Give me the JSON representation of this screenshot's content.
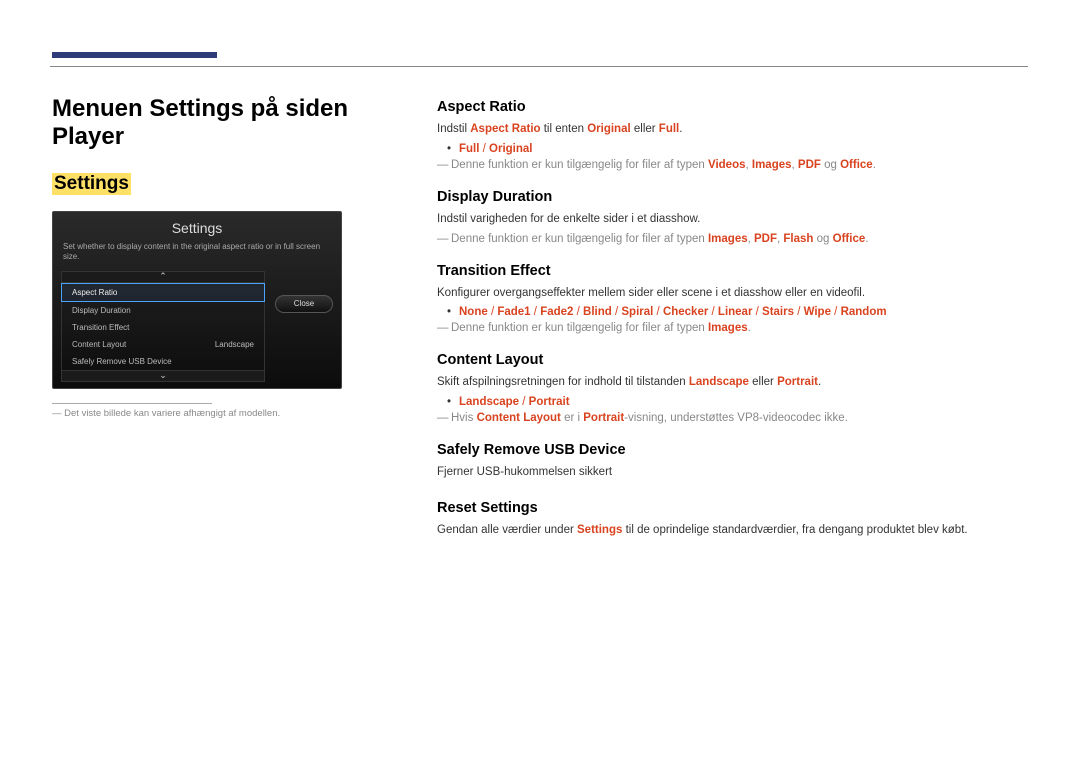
{
  "page_title": "Menuen Settings på siden Player",
  "settings_label": "Settings",
  "panel": {
    "title": "Settings",
    "subtitle": "Set whether to display content in the original aspect ratio or in full screen size.",
    "scroll_up": "⌃",
    "scroll_down": "⌄",
    "close": "Close",
    "items": [
      {
        "label": "Aspect Ratio",
        "value": "",
        "selected": true
      },
      {
        "label": "Display Duration",
        "value": ""
      },
      {
        "label": "Transition Effect",
        "value": ""
      },
      {
        "label": "Content Layout",
        "value": "Landscape"
      },
      {
        "label": "Safely Remove USB Device",
        "value": ""
      }
    ]
  },
  "caption": "Det viste billede kan variere afhængigt af modellen.",
  "sections": {
    "aspect_ratio": {
      "title": "Aspect Ratio",
      "p1a": "Indstil ",
      "p1b": "Aspect Ratio",
      "p1c": " til enten ",
      "p1d": "Original",
      "p1e": " eller ",
      "p1f": "Full",
      "p1g": ".",
      "bullet_full": "Full",
      "bullet_sep": " / ",
      "bullet_original": "Original",
      "note_a": "Denne funktion er kun tilgængelig for filer af typen ",
      "note_v": "Videos",
      "note_c1": ", ",
      "note_i": "Images",
      "note_c2": ", ",
      "note_p": "PDF",
      "note_og": " og ",
      "note_o": "Office",
      "note_end": "."
    },
    "display_duration": {
      "title": "Display Duration",
      "p1": "Indstil varigheden for de enkelte sider i et diasshow.",
      "note_a": "Denne funktion er kun tilgængelig for filer af typen ",
      "note_i": "Images",
      "note_c1": ", ",
      "note_p": "PDF",
      "note_c2": ", ",
      "note_f": "Flash",
      "note_og": " og ",
      "note_o": "Office",
      "note_end": "."
    },
    "transition_effect": {
      "title": "Transition Effect",
      "p1": "Konfigurer overgangseffekter mellem sider eller scene i et diasshow eller en videofil.",
      "opts": [
        "None",
        "Fade1",
        "Fade2",
        "Blind",
        "Spiral",
        "Checker",
        "Linear",
        "Stairs",
        "Wipe",
        "Random"
      ],
      "sep": " / ",
      "note_a": "Denne funktion er kun tilgængelig for filer af typen ",
      "note_i": "Images",
      "note_end": "."
    },
    "content_layout": {
      "title": "Content Layout",
      "p1a": "Skift afspilningsretningen for indhold til tilstanden ",
      "p1b": "Landscape",
      "p1c": " eller ",
      "p1d": "Portrait",
      "p1e": ".",
      "bullet_l": "Landscape",
      "bullet_sep": " / ",
      "bullet_p": "Portrait",
      "note_a": "Hvis ",
      "note_b": "Content Layout",
      "note_c": " er i ",
      "note_d": "Portrait",
      "note_e": "-visning, understøttes VP8-videocodec ikke."
    },
    "safely_remove": {
      "title": "Safely Remove USB Device",
      "p1": "Fjerner USB-hukommelsen sikkert"
    },
    "reset_settings": {
      "title": "Reset Settings",
      "p1a": "Gendan alle værdier under ",
      "p1b": "Settings",
      "p1c": " til de oprindelige standardværdier, fra dengang produktet blev købt."
    }
  }
}
